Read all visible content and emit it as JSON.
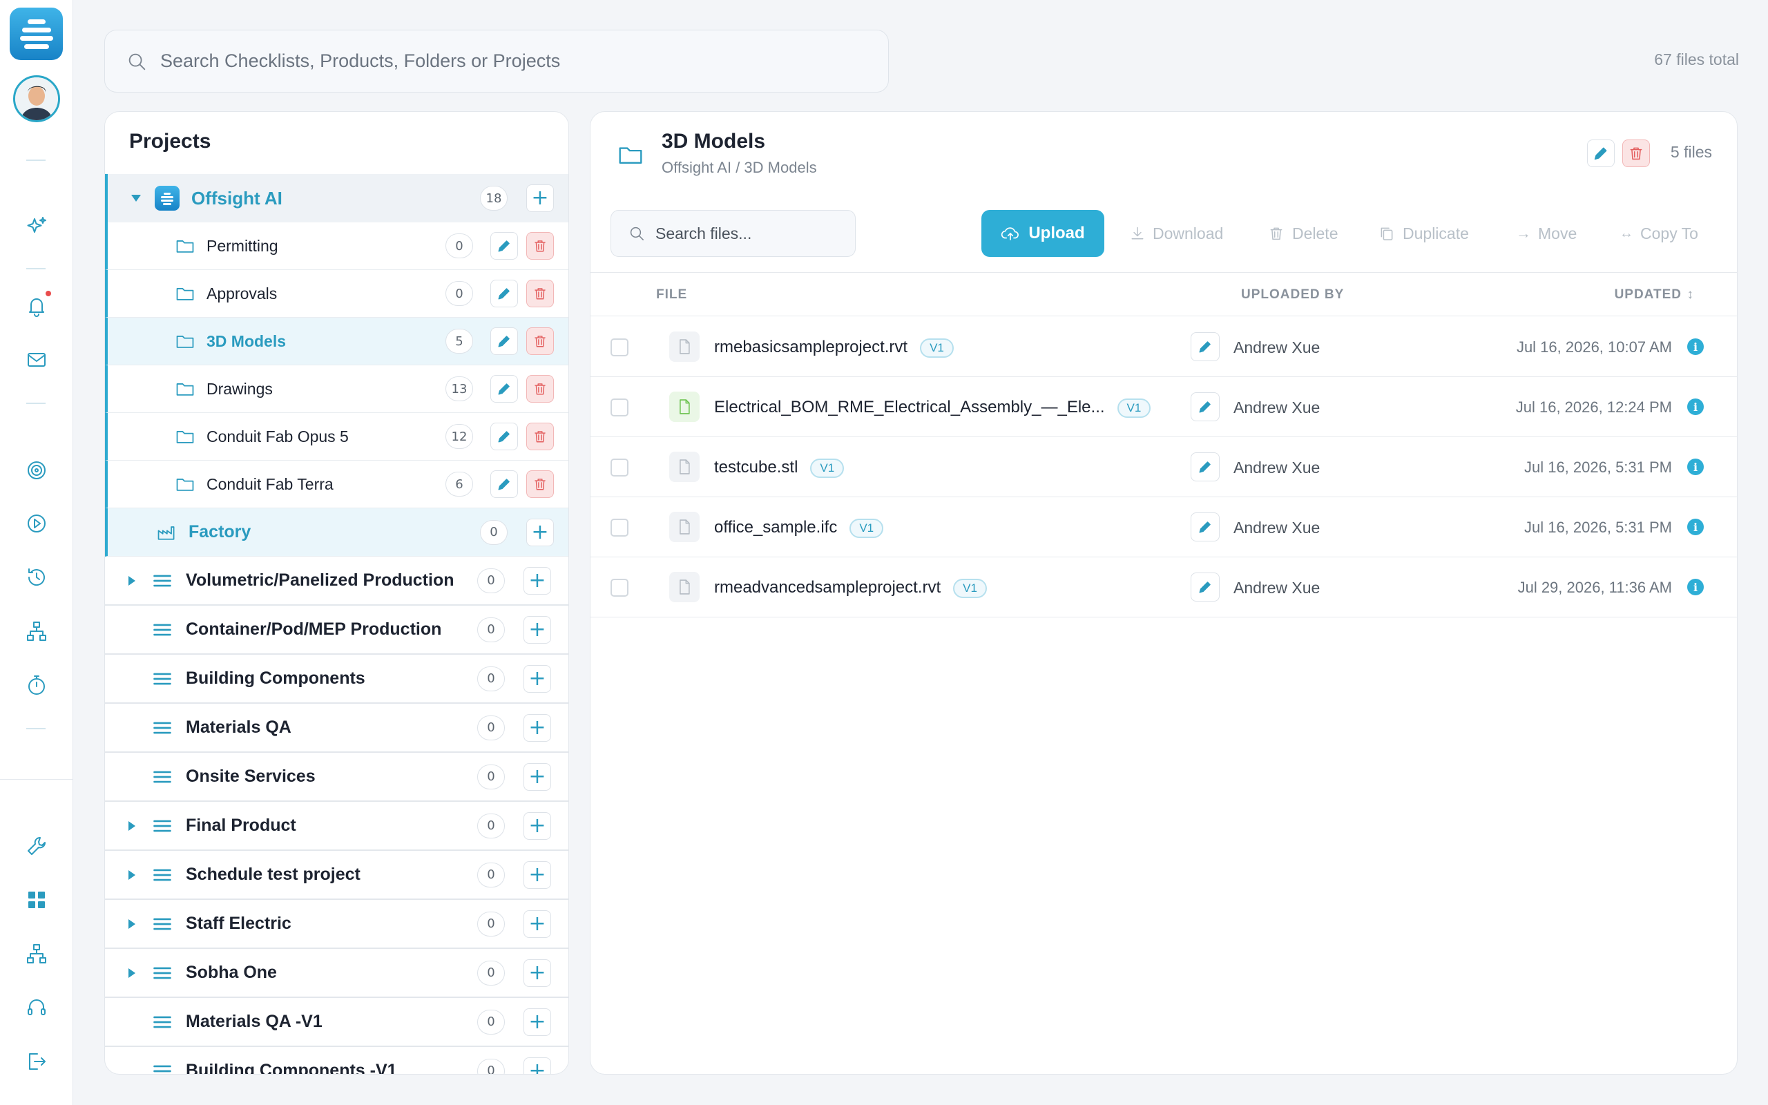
{
  "search": {
    "placeholder": "Search Checklists, Products, Folders or Projects"
  },
  "files_total": "67 files total",
  "projects_panel": {
    "title": "Projects",
    "root": {
      "label": "Offsight AI",
      "count": "18"
    },
    "folders": [
      {
        "label": "Permitting",
        "count": "0"
      },
      {
        "label": "Approvals",
        "count": "0"
      },
      {
        "label": "3D Models",
        "count": "5"
      },
      {
        "label": "Drawings",
        "count": "13"
      },
      {
        "label": "Conduit Fab Opus 5",
        "count": "12"
      },
      {
        "label": "Conduit Fab Terra",
        "count": "6"
      }
    ],
    "factory": {
      "label": "Factory",
      "count": "0"
    },
    "projects": [
      {
        "label": "Volumetric/Panelized Production",
        "count": "0",
        "expandable": true
      },
      {
        "label": "Container/Pod/MEP Production",
        "count": "0",
        "expandable": false
      },
      {
        "label": "Building Components",
        "count": "0",
        "expandable": false
      },
      {
        "label": "Materials QA",
        "count": "0",
        "expandable": false
      },
      {
        "label": "Onsite Services",
        "count": "0",
        "expandable": false
      },
      {
        "label": "Final Product",
        "count": "0",
        "expandable": true
      },
      {
        "label": "Schedule test project",
        "count": "0",
        "expandable": true
      },
      {
        "label": "Staff Electric",
        "count": "0",
        "expandable": true
      },
      {
        "label": "Sobha One",
        "count": "0",
        "expandable": true
      },
      {
        "label": "Materials QA -V1",
        "count": "0",
        "expandable": false
      },
      {
        "label": "Building Components -V1",
        "count": "0",
        "expandable": false
      }
    ]
  },
  "folder_view": {
    "title": "3D Models",
    "breadcrumb": "Offsight AI / 3D Models",
    "file_count": "5 files",
    "search_placeholder": "Search files...",
    "toolbar": {
      "upload": "Upload",
      "download": "Download",
      "delete": "Delete",
      "duplicate": "Duplicate",
      "move": "Move",
      "copy_to": "Copy To"
    },
    "columns": {
      "file": "FILE",
      "uploaded_by": "UPLOADED BY",
      "updated": "UPDATED"
    },
    "files": [
      {
        "name": "rmebasicsampleproject.rvt",
        "version": "V1",
        "uploaded_by": "Andrew Xue",
        "updated": "Jul 16, 2026, 10:07 AM",
        "icon": "file-icon"
      },
      {
        "name": "Electrical_BOM_RME_Electrical_Assembly_—_Ele...",
        "version": "V1",
        "uploaded_by": "Andrew Xue",
        "updated": "Jul 16, 2026, 12:24 PM",
        "icon": "spreadsheet-file-icon"
      },
      {
        "name": "testcube.stl",
        "version": "V1",
        "uploaded_by": "Andrew Xue",
        "updated": "Jul 16, 2026, 5:31 PM",
        "icon": "file-icon"
      },
      {
        "name": "office_sample.ifc",
        "version": "V1",
        "uploaded_by": "Andrew Xue",
        "updated": "Jul 16, 2026, 5:31 PM",
        "icon": "file-icon"
      },
      {
        "name": "rmeadvancedsampleproject.rvt",
        "version": "V1",
        "uploaded_by": "Andrew Xue",
        "updated": "Jul 29, 2026, 11:36 AM",
        "icon": "file-icon"
      }
    ]
  },
  "colors": {
    "accent": "#2eaed6",
    "danger": "#e35d5d",
    "selected_bg": "#eaf6fb"
  }
}
